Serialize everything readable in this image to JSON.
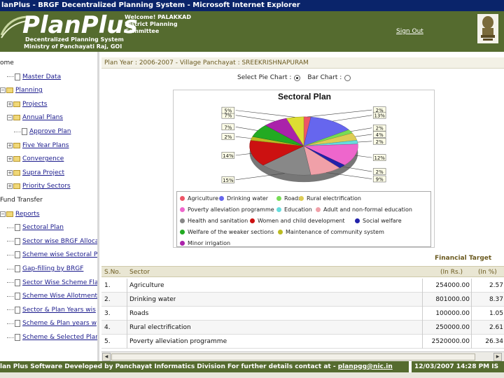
{
  "window": {
    "title": "lanPlus - BRGF Decentralized Planning System - Microsoft Internet Explorer"
  },
  "header": {
    "logo": "PlanPlus",
    "subtitle_1": "Decentralized Planning System",
    "subtitle_2": "Ministry of Panchayati Raj, GOI",
    "welcome_1": "Welcome! PALAKKAD",
    "welcome_2": "District Planning",
    "welcome_3": "Committee",
    "sign_out": "Sign Out"
  },
  "nav": {
    "items": [
      {
        "label": "ome",
        "indent": 0,
        "kind": "plain"
      },
      {
        "label": "Master Data",
        "indent": 1,
        "kind": "doc"
      },
      {
        "label": "Planning",
        "indent": 0,
        "kind": "folder"
      },
      {
        "label": "Projects",
        "indent": 1,
        "kind": "folder"
      },
      {
        "label": "Annual Plans",
        "indent": 1,
        "kind": "folder"
      },
      {
        "label": "Approve Plan",
        "indent": 2,
        "kind": "doc"
      },
      {
        "label": "Five Year Plans",
        "indent": 1,
        "kind": "folder"
      },
      {
        "label": "Convergence",
        "indent": 1,
        "kind": "folder"
      },
      {
        "label": "Supra Project",
        "indent": 1,
        "kind": "folder"
      },
      {
        "label": "Priority Sectors",
        "indent": 1,
        "kind": "folder"
      },
      {
        "label": "Fund Transfer",
        "indent": 0,
        "kind": "plain"
      },
      {
        "label": "Reports",
        "indent": 0,
        "kind": "folder"
      },
      {
        "label": "Sectoral Plan",
        "indent": 1,
        "kind": "doc"
      },
      {
        "label": "Sector wise BRGF Alloca",
        "indent": 1,
        "kind": "doc"
      },
      {
        "label": "Scheme wise Sectoral P",
        "indent": 1,
        "kind": "doc"
      },
      {
        "label": "Gap-filling by BRGF",
        "indent": 1,
        "kind": "doc"
      },
      {
        "label": "Sector Wise Scheme Fla",
        "indent": 1,
        "kind": "doc"
      },
      {
        "label": "Scheme Wise Allotment",
        "indent": 1,
        "kind": "doc"
      },
      {
        "label": "Sector & Plan Years wis",
        "indent": 1,
        "kind": "doc"
      },
      {
        "label": "Scheme & Plan years w",
        "indent": 1,
        "kind": "doc"
      },
      {
        "label": "Scheme & Selected Plar",
        "indent": 1,
        "kind": "doc"
      }
    ]
  },
  "main": {
    "plan_year_bar": "Plan Year : 2006-2007 - Village Panchayat : SREEKRISHNAPURAM",
    "select_pie": "Select Pie Chart :",
    "bar_chart": "Bar Chart :",
    "financial_target": "Financial Target",
    "table": {
      "headers": [
        "S.No.",
        "Sector",
        "(In Rs.)",
        "(In %)"
      ],
      "rows": [
        [
          "1.",
          "Agriculture",
          "254000.00",
          "2.57"
        ],
        [
          "2.",
          "Drinking water",
          "801000.00",
          "8.37"
        ],
        [
          "3.",
          "Roads",
          "100000.00",
          "1.05"
        ],
        [
          "4.",
          "Rural electrification",
          "250000.00",
          "2.61"
        ],
        [
          "5.",
          "Poverty alleviation programme",
          "2520000.00",
          "26.34"
        ]
      ]
    }
  },
  "chart_data": {
    "type": "pie",
    "title": "Sectoral Plan",
    "slices": [
      {
        "label": "2%",
        "value": 2,
        "color": "#ee5566"
      },
      {
        "label": "13%",
        "value": 13,
        "color": "#6666ee"
      },
      {
        "label": "2%",
        "value": 2,
        "color": "#77dd55"
      },
      {
        "label": "4%",
        "value": 4,
        "color": "#ddcc55"
      },
      {
        "label": "2%",
        "value": 2,
        "color": "#66dddd"
      },
      {
        "label": "12%",
        "value": 12,
        "color": "#ee66cc"
      },
      {
        "label": "2%",
        "value": 2,
        "color": "#2222aa"
      },
      {
        "label": "9%",
        "value": 9,
        "color": "#f0a0a8"
      },
      {
        "label": "15%",
        "value": 15,
        "color": "#888888"
      },
      {
        "label": "14%",
        "value": 14,
        "color": "#cc1111"
      },
      {
        "label": "2%",
        "value": 2,
        "color": "#bbbb22"
      },
      {
        "label": "7%",
        "value": 7,
        "color": "#22aa22"
      },
      {
        "label": "7%",
        "value": 7,
        "color": "#aa22aa"
      },
      {
        "label": "5%",
        "value": 5,
        "color": "#dddd33"
      }
    ],
    "legend": [
      {
        "name": "Agriculture",
        "color": "#ee5566"
      },
      {
        "name": "Drinking water",
        "color": "#6666ee"
      },
      {
        "name": "Roads",
        "color": "#77dd55"
      },
      {
        "name": "Rural electrification",
        "color": "#ddcc55"
      },
      {
        "name": "Poverty alleviation programme",
        "color": "#ee66cc"
      },
      {
        "name": "Education",
        "color": "#66dddd"
      },
      {
        "name": "Adult and non-formal education",
        "color": "#f0a0a8"
      },
      {
        "name": "Health and sanitation",
        "color": "#888888"
      },
      {
        "name": "Women and child development",
        "color": "#cc1111"
      },
      {
        "name": "Social welfare",
        "color": "#2222aa"
      },
      {
        "name": "Welfare of the weaker sections",
        "color": "#22aa22"
      },
      {
        "name": "Maintenance of community system",
        "color": "#bbbb22"
      },
      {
        "name": "Minor irrigation",
        "color": "#aa22aa"
      }
    ]
  },
  "footer": {
    "text": "lan Plus Software Developed by Panchayat Informatics Division For further details contact at - ",
    "email": "planpgg@nic.in",
    "datetime": "12/03/2007 14:28 PM IS"
  }
}
